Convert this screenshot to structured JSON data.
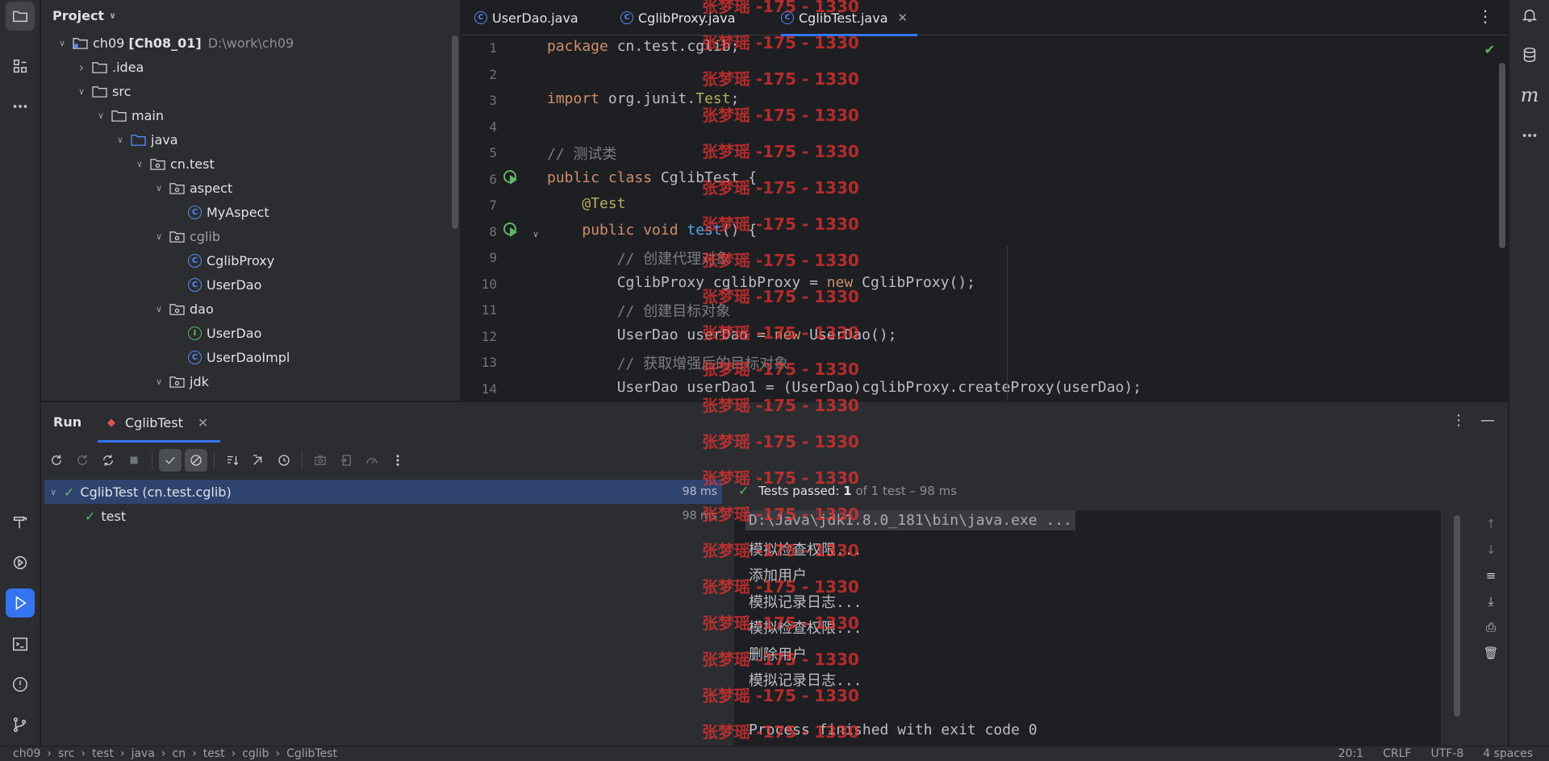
{
  "project": {
    "title": "Project",
    "tree": [
      {
        "label": "ch09 [Ch08_01]",
        "extra": "D:\\work\\ch09",
        "depth": 0,
        "kind": "module",
        "expanded": true
      },
      {
        "label": ".idea",
        "depth": 1,
        "kind": "folder",
        "expanded": false
      },
      {
        "label": "src",
        "depth": 1,
        "kind": "folder",
        "expanded": true
      },
      {
        "label": "main",
        "depth": 2,
        "kind": "folder",
        "expanded": true
      },
      {
        "label": "java",
        "depth": 3,
        "kind": "source-folder",
        "expanded": true
      },
      {
        "label": "cn.test",
        "depth": 4,
        "kind": "package",
        "expanded": true
      },
      {
        "label": "aspect",
        "depth": 5,
        "kind": "package",
        "expanded": true
      },
      {
        "label": "MyAspect",
        "depth": 6,
        "kind": "class"
      },
      {
        "label": "cglib",
        "depth": 5,
        "kind": "package",
        "expanded": true,
        "muted": true
      },
      {
        "label": "CglibProxy",
        "depth": 6,
        "kind": "class"
      },
      {
        "label": "UserDao",
        "depth": 6,
        "kind": "class"
      },
      {
        "label": "dao",
        "depth": 5,
        "kind": "package",
        "expanded": true
      },
      {
        "label": "UserDao",
        "depth": 6,
        "kind": "interface"
      },
      {
        "label": "UserDaoImpl",
        "depth": 6,
        "kind": "class"
      },
      {
        "label": "jdk",
        "depth": 5,
        "kind": "package",
        "expanded": true
      }
    ]
  },
  "editor": {
    "tabs": [
      {
        "label": "UserDao.java",
        "active": false
      },
      {
        "label": "CglibProxy.java",
        "active": false
      },
      {
        "label": "CglibTest.java",
        "active": true
      }
    ],
    "line_numbers": [
      "1",
      "2",
      "3",
      "4",
      "5",
      "6",
      "7",
      "8",
      "9",
      "10",
      "11",
      "12",
      "13",
      "14"
    ],
    "lines": [
      [
        [
          "kw",
          "package "
        ],
        [
          "",
          "cn.test.cglib;"
        ]
      ],
      [],
      [
        [
          "kw",
          "import "
        ],
        [
          "",
          "org.junit."
        ],
        [
          "ann",
          "Test"
        ],
        [
          "",
          ";"
        ]
      ],
      [],
      [
        [
          "cm",
          "// 测试类"
        ]
      ],
      [
        [
          "kw",
          "public class "
        ],
        [
          "",
          "CglibTest {"
        ]
      ],
      [
        [
          "",
          "    "
        ],
        [
          "ann",
          "@Test"
        ]
      ],
      [
        [
          "",
          "    "
        ],
        [
          "kw",
          "public void "
        ],
        [
          "fn",
          "test"
        ],
        [
          "",
          "() {"
        ]
      ],
      [
        [
          "",
          "        "
        ],
        [
          "cm",
          "// 创建代理对象"
        ]
      ],
      [
        [
          "",
          "        CglibProxy cglibProxy = "
        ],
        [
          "kw",
          "new "
        ],
        [
          "",
          "CglibProxy();"
        ]
      ],
      [
        [
          "",
          "        "
        ],
        [
          "cm",
          "// 创建目标对象"
        ]
      ],
      [
        [
          "",
          "        UserDao userDao = "
        ],
        [
          "kw",
          "new "
        ],
        [
          "",
          "UserDao();"
        ]
      ],
      [
        [
          "",
          "        "
        ],
        [
          "cm",
          "// 获取增强后的目标对象"
        ]
      ],
      [
        [
          "",
          "        UserDao userDao1 = (UserDao)cglibProxy.createProxy(userDao);"
        ]
      ]
    ]
  },
  "run": {
    "title": "Run",
    "tab_label": "CglibTest",
    "tests": [
      {
        "label": "CglibTest (cn.test.cglib)",
        "duration": "98 ms",
        "selected": true
      },
      {
        "label": "test",
        "duration": "98 ms",
        "selected": false
      }
    ],
    "passed_prefix": "Tests passed: ",
    "passed_count": "1",
    "passed_suffix": " of 1 test – 98 ms",
    "console": [
      "D:\\Java\\jdk1.8.0_181\\bin\\java.exe ...",
      "模拟检查权限...",
      "添加用户",
      "模拟记录日志...",
      "模拟检查权限...",
      "删除用户",
      "模拟记录日志...",
      "",
      "Process finished with exit code 0"
    ]
  },
  "status": {
    "breadcrumbs": [
      "ch09",
      "src",
      "test",
      "java",
      "cn",
      "test",
      "cglib",
      "CglibTest"
    ],
    "position": "20:1",
    "line_ending": "CRLF",
    "encoding": "UTF-8",
    "indent": "4 spaces"
  },
  "watermark": "张梦瑶 -175 - 1330",
  "colors": {
    "accent": "#3574f0",
    "pass": "#5fb865",
    "watermark": "#eb3232"
  }
}
